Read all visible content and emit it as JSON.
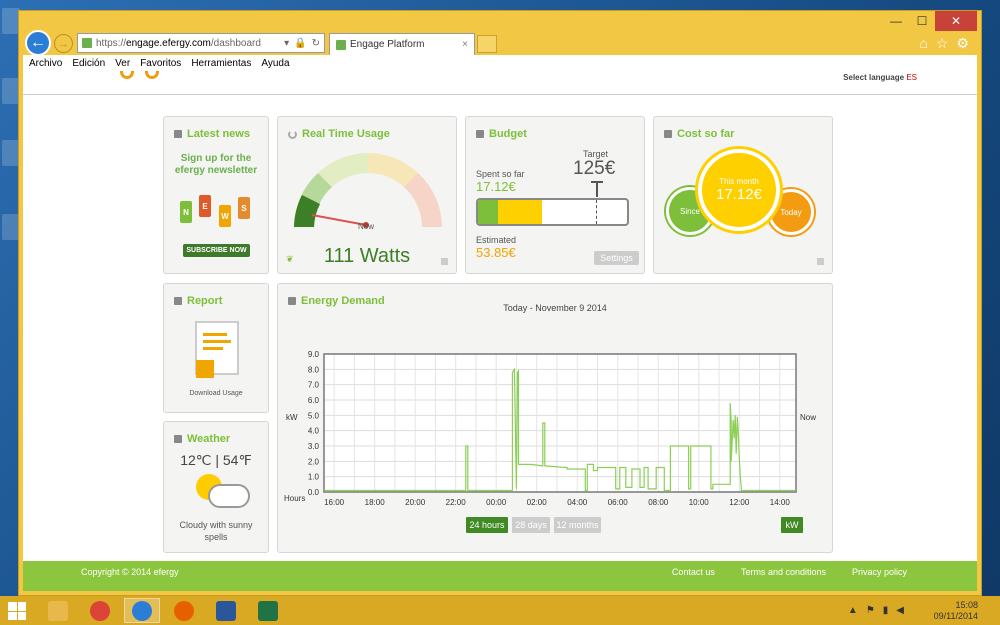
{
  "browser": {
    "url_prefix": "https://",
    "url_host": "engage.efergy.com",
    "url_path": "/dashboard",
    "tab_title": "Engage Platform",
    "tab_close": "×",
    "menu": [
      "Archivo",
      "Edición",
      "Ver",
      "Favoritos",
      "Herramientas",
      "Ayuda"
    ]
  },
  "site_header": {
    "language": "Select language",
    "language_flag": "ES"
  },
  "cards": {
    "news": {
      "title": "Latest news",
      "headline_1": "Sign up for the",
      "headline_2": "efergy newsletter",
      "letters": [
        "N",
        "E",
        "W",
        "S"
      ],
      "button": "SUBSCRIBE NOW"
    },
    "realtime": {
      "title": "Real Time Usage",
      "gauge_label": "Now",
      "value": "111 Watts"
    },
    "budget": {
      "title": "Budget",
      "spent_label": "Spent so far",
      "spent_value": "17.12€",
      "target_label": "Target",
      "target_value": "125€",
      "estimated_label": "Estimated",
      "estimated_value": "53.85€",
      "settings": "Settings",
      "spent_fraction": 0.137,
      "estimated_fraction": 0.431
    },
    "cost": {
      "title": "Cost so far",
      "this_month_label": "This month",
      "this_month_value": "17.12€",
      "since_label": "Since",
      "today_label": "Today"
    },
    "report": {
      "title": "Report",
      "download_label": "Download Usage"
    },
    "weather": {
      "title": "Weather",
      "temp": "12℃ | 54℉",
      "desc": "Cloudy with sunny spells"
    },
    "demand": {
      "title": "Energy Demand",
      "subtitle": "Today - November 9 2014",
      "buttons": [
        "24 hours",
        "28 days",
        "12 months"
      ],
      "unit_button": "kW"
    }
  },
  "chart_data": {
    "type": "line",
    "title": "Today - November 9 2014",
    "xlabel": "Hours",
    "ylabel": "kW",
    "right_label": "Now",
    "x_ticks": [
      "16:00",
      "18:00",
      "20:00",
      "22:00",
      "00:00",
      "02:00",
      "04:00",
      "06:00",
      "08:00",
      "10:00",
      "12:00",
      "14:00"
    ],
    "ylim": [
      0,
      9
    ],
    "y_ticks": [
      "0.0",
      "1.0",
      "2.0",
      "3.0",
      "4.0",
      "5.0",
      "6.0",
      "7.0",
      "8.0",
      "9.0"
    ],
    "xlim_hours": [
      15.5,
      38.8
    ],
    "grid": true,
    "series": [
      {
        "color": "#8ccf55",
        "x": [
          15.5,
          22.5,
          22.5,
          22.6,
          22.6,
          24.8,
          24.8,
          24.9,
          25.0,
          25.05,
          25.1,
          25.1,
          25.7,
          26.3,
          26.3,
          26.4,
          26.4,
          27.5,
          27.5,
          28.4,
          28.4,
          28.5,
          28.5,
          28.8,
          28.8,
          29.0,
          29.0,
          29.9,
          29.9,
          30.1,
          30.1,
          30.4,
          30.4,
          30.7,
          30.7,
          31.1,
          31.1,
          31.3,
          31.3,
          31.5,
          31.5,
          31.9,
          31.9,
          32.3,
          32.3,
          32.6,
          32.6,
          33.5,
          33.5,
          33.6,
          33.6,
          34.6,
          34.6,
          34.7,
          34.7,
          35.55,
          35.55,
          35.6,
          35.6,
          35.7,
          35.75,
          35.8,
          35.85,
          35.9,
          35.95,
          36.0,
          36.05,
          36.1,
          36.1,
          38.8
        ],
        "y": [
          0.1,
          0.1,
          3.0,
          3.0,
          0.1,
          0.1,
          7.8,
          8.0,
          0.2,
          7.8,
          7.9,
          1.8,
          1.8,
          1.7,
          4.5,
          4.5,
          1.7,
          1.6,
          1.5,
          1.5,
          0.1,
          0.1,
          1.8,
          1.8,
          1.4,
          1.4,
          1.6,
          1.6,
          0.2,
          0.2,
          1.6,
          1.6,
          0.3,
          0.3,
          1.5,
          1.5,
          0.3,
          0.3,
          1.6,
          1.6,
          0.2,
          0.2,
          1.6,
          1.6,
          0.1,
          0.1,
          3.0,
          3.0,
          0.2,
          0.2,
          3.0,
          3.0,
          0.2,
          0.2,
          0.5,
          0.5,
          5.8,
          4.6,
          2.0,
          4.7,
          3.5,
          5.0,
          2.5,
          4.9,
          3.8,
          2.2,
          1.0,
          0.3,
          0.1,
          0.1
        ]
      }
    ]
  },
  "footer": {
    "copyright": "Copyright © 2014 efergy",
    "links": [
      "Contact us",
      "Terms and conditions",
      "Privacy policy"
    ]
  },
  "taskbar": {
    "time": "15:08",
    "date": "09/11/2014"
  },
  "colors": {
    "brand_green": "#7dbf3a",
    "dark_green": "#3d7f27",
    "orange": "#f0a500",
    "yellow": "#ffd000",
    "window_chrome": "#f2c744"
  }
}
